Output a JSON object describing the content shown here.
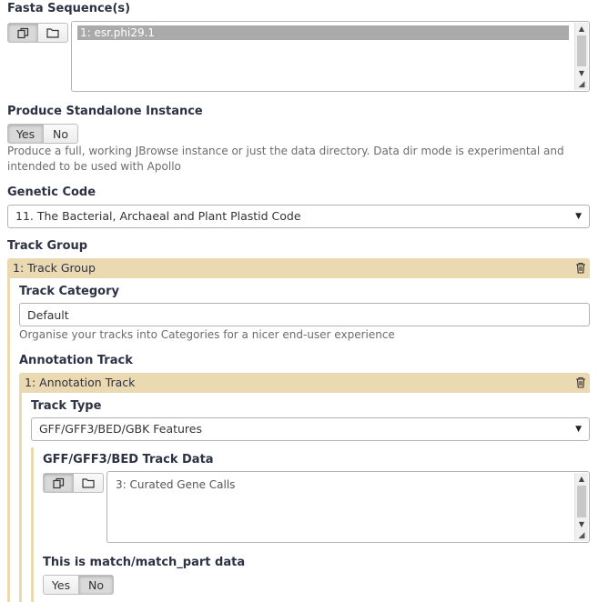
{
  "fasta": {
    "label": "Fasta Sequence(s)",
    "selected": "1: esr.phi29.1"
  },
  "standalone": {
    "label": "Produce Standalone Instance",
    "yes": "Yes",
    "no": "No",
    "help": "Produce a full, working JBrowse instance or just the data directory. Data dir mode is experimental and intended to be used with Apollo"
  },
  "genetic_code": {
    "label": "Genetic Code",
    "value": "11. The Bacterial, Archaeal and Plant Plastid Code"
  },
  "track_group": {
    "label": "Track Group",
    "header": "1: Track Group",
    "category_label": "Track Category",
    "category_value": "Default",
    "category_help": "Organise your tracks into Categories for a nicer end-user experience",
    "annotation_label": "Annotation Track",
    "annotation_header": "1: Annotation Track",
    "track_type_label": "Track Type",
    "track_type_value": "GFF/GFF3/BED/GBK Features",
    "gff_label": "GFF/GFF3/BED Track Data",
    "gff_value": "3: Curated Gene Calls",
    "match_label": "This is match/match_part data",
    "match_yes": "Yes",
    "match_no": "No"
  },
  "icons": [
    "copy-icon",
    "folder-icon",
    "trash-icon",
    "caret-down-icon"
  ],
  "colors": {
    "repeat_header": "#ebd9b2",
    "selected_option": "#aaaaaa",
    "active_toggle": "#d9d9d9"
  }
}
